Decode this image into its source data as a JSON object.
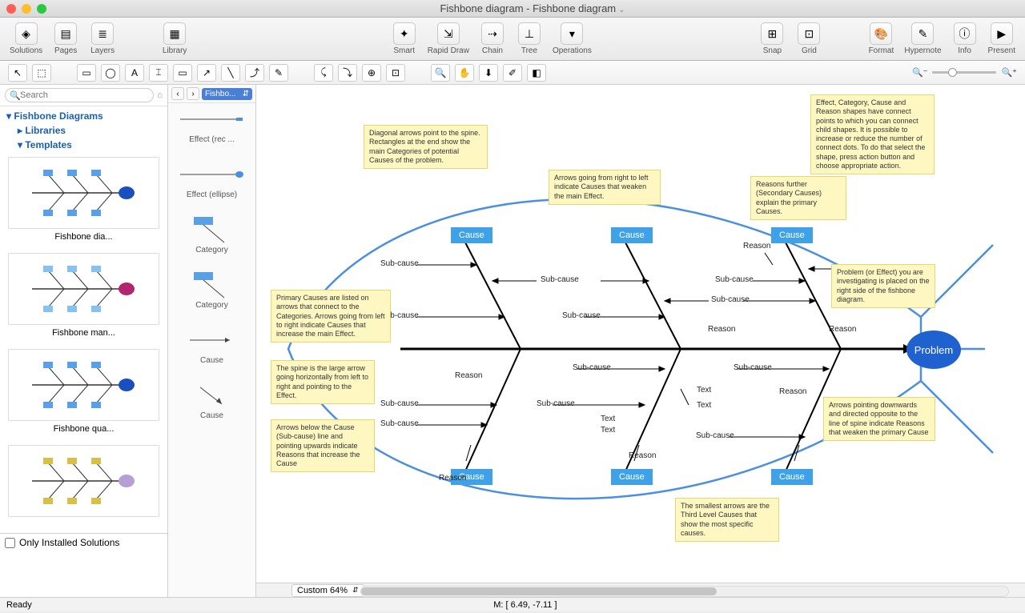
{
  "title": "Fishbone diagram - Fishbone diagram",
  "toolbar": [
    {
      "id": "solutions",
      "label": "Solutions",
      "glyph": "◈"
    },
    {
      "id": "pages",
      "label": "Pages",
      "glyph": "▤"
    },
    {
      "id": "layers",
      "label": "Layers",
      "glyph": "≣"
    },
    {
      "id": "library",
      "label": "Library",
      "glyph": "▦",
      "gapBefore": true
    },
    {
      "id": "smart",
      "label": "Smart",
      "glyph": "✦",
      "gapBefore": true,
      "spacerBefore": true
    },
    {
      "id": "rapid",
      "label": "Rapid Draw",
      "glyph": "⇲"
    },
    {
      "id": "chain",
      "label": "Chain",
      "glyph": "⇢"
    },
    {
      "id": "tree",
      "label": "Tree",
      "glyph": "⊥"
    },
    {
      "id": "operations",
      "label": "Operations",
      "glyph": "▾"
    },
    {
      "id": "snap",
      "label": "Snap",
      "glyph": "⊞",
      "spacerBefore": true
    },
    {
      "id": "grid",
      "label": "Grid",
      "glyph": "⊡"
    },
    {
      "id": "format",
      "label": "Format",
      "glyph": "🎨",
      "gapBefore": true
    },
    {
      "id": "hypernote",
      "label": "Hypernote",
      "glyph": "✎"
    },
    {
      "id": "info",
      "label": "Info",
      "glyph": "ⓘ"
    },
    {
      "id": "present",
      "label": "Present",
      "glyph": "▶"
    }
  ],
  "tools": [
    "↖",
    "⬚",
    "",
    "▭",
    "◯",
    "A",
    "⌶",
    "▭",
    "↗",
    "╲",
    "⤴",
    "✎",
    "",
    "⤹",
    "⤵",
    "⊕",
    "⊡",
    "",
    "🔍",
    "✋",
    "⬇",
    "✐",
    "◧"
  ],
  "search_placeholder": "Search",
  "tree": {
    "root": "Fishbone Diagrams",
    "items": [
      {
        "label": "Libraries",
        "bold": true
      },
      {
        "label": "Templates",
        "bold": true
      }
    ]
  },
  "thumbs": [
    {
      "label": "Fishbone dia...",
      "color": "#5aa0e6",
      "head": "#1b4fbd"
    },
    {
      "label": "Fishbone man...",
      "color": "#86c2ef",
      "head": "#b3266e"
    },
    {
      "label": "Fishbone qua...",
      "color": "#5aa0e6",
      "head": "#1b4fbd"
    },
    {
      "label": "",
      "color": "#d7c04a",
      "head": "#b69fd6"
    }
  ],
  "only_installed": "Only Installed Solutions",
  "shapes": {
    "dropdown": "Fishbo...",
    "items": [
      {
        "name": "Effect (rec ...",
        "svg": "rect"
      },
      {
        "name": "Effect (ellipse)",
        "svg": "ellipse"
      },
      {
        "name": "Category",
        "svg": "catdiag"
      },
      {
        "name": "Category",
        "svg": "catdiag"
      },
      {
        "name": "Cause",
        "svg": "harrow"
      },
      {
        "name": "Cause",
        "svg": "diagarrow"
      }
    ]
  },
  "notes": {
    "n1": "Diagonal arrows point to the spine. Rectangles at the end show the main Categories of potential Causes of the problem.",
    "n2": "Arrows going from right to left indicate Causes that weaken the main Effect.",
    "n3": "Reasons further (Secondary Causes) explain the primary Causes.",
    "n4": "Effect, Category, Cause and Reason shapes have connect points to which you can connect child shapes. It is possible to increase or reduce the number of connect dots. To do that select the shape, press action button and choose appropriate action.",
    "n5": "Primary Causes are listed on arrows that connect to the Categories. Arrows going from left to right indicate Causes that increase the main Effect.",
    "n6": "The spine is the large arrow going horizontally from left to right and pointing to the Effect.",
    "n7": "Arrows below the Cause (Sub-cause) line and pointing upwards indicate Reasons that increase the Cause",
    "n8": "The smallest arrows are the Third Level Causes that show the most specific causes.",
    "n9": "Arrows pointing downwards and directed opposite to the line of spine indicate Reasons that weaken the primary Cause",
    "n10": "Problem (or Effect) you are investigating is placed on the right side of the fishbone diagram."
  },
  "labels": {
    "cause": "Cause",
    "subcause": "Sub-cause",
    "reason": "Reason",
    "text": "Text",
    "problem": "Problem"
  },
  "zoom": "Custom 64%",
  "mouse": "M: [ 6.49, -7.11 ]",
  "status": "Ready"
}
